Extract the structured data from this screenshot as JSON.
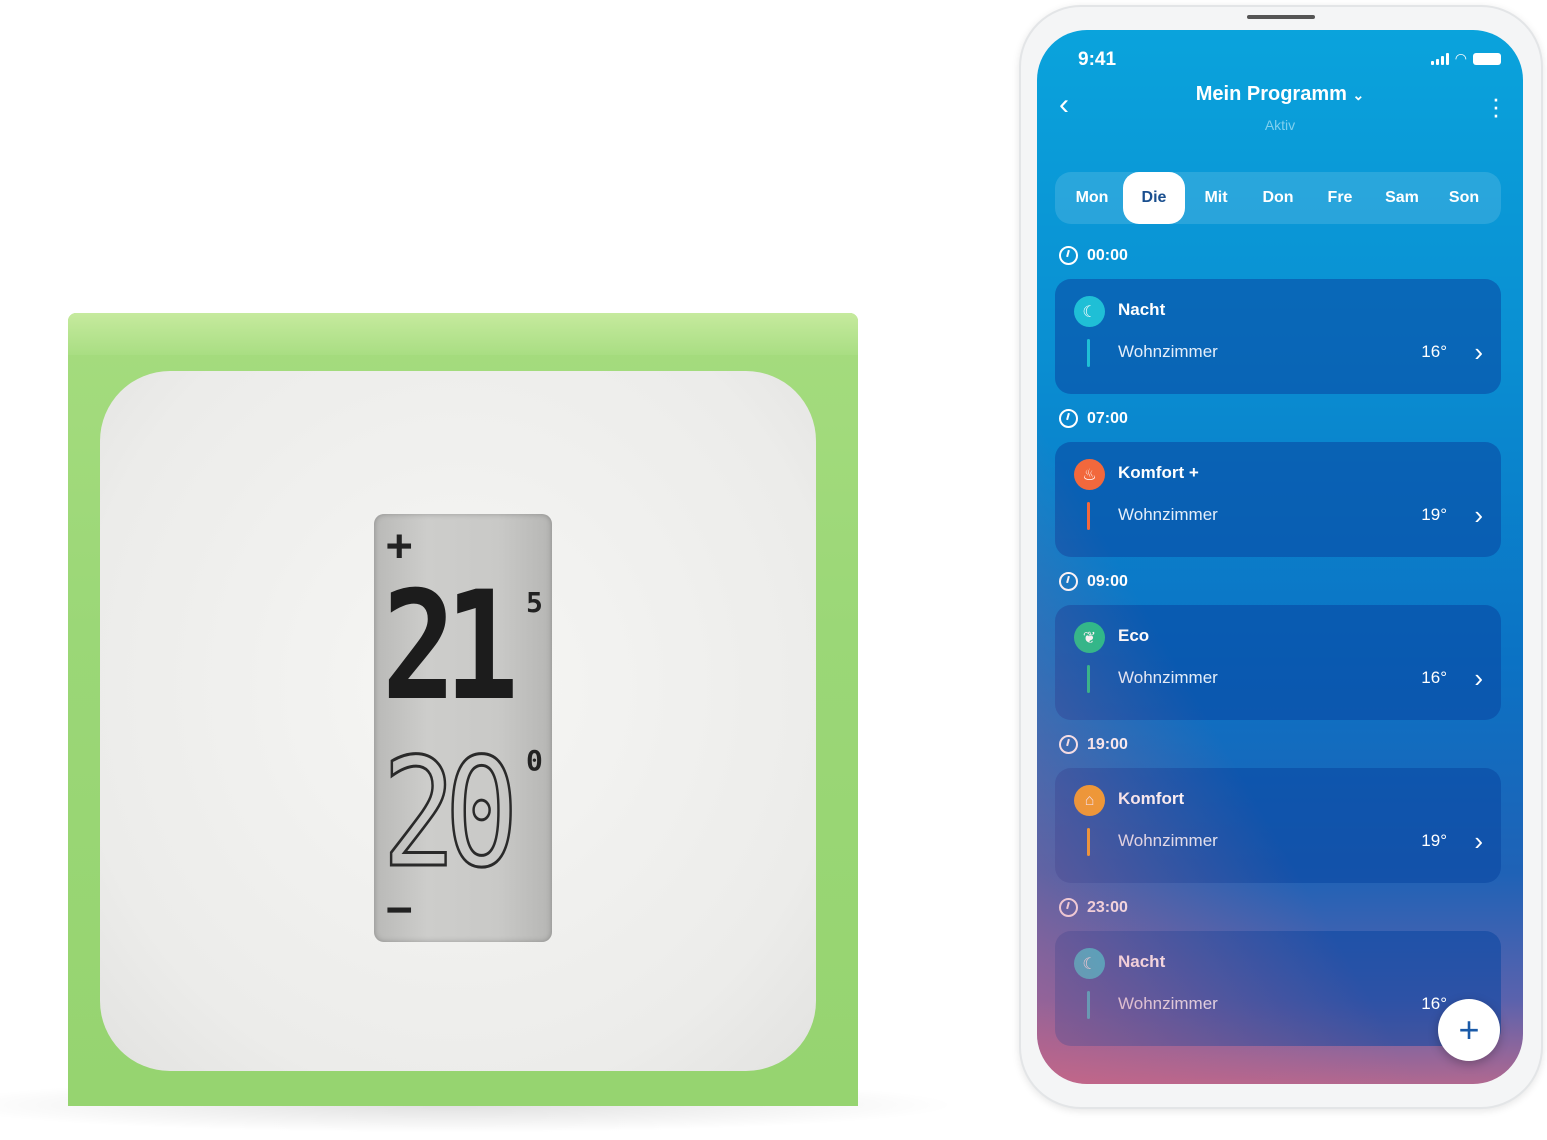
{
  "thermostat": {
    "plus": "+",
    "minus": "−",
    "current_temp": "21",
    "current_decimal": "5",
    "target_temp": "20",
    "target_decimal": "0"
  },
  "app": {
    "status_time": "9:41",
    "title": "Mein Programm",
    "subtitle": "Aktiv",
    "days": [
      "Mon",
      "Die",
      "Mit",
      "Don",
      "Fre",
      "Sam",
      "Son"
    ],
    "selected_day": "Die",
    "schedule": [
      {
        "time": "00:00",
        "mode": "Nacht",
        "room": "Wohnzimmer",
        "temp": "16°",
        "icon": "moon-icon",
        "color": "#1fbfd6"
      },
      {
        "time": "07:00",
        "mode": "Komfort +",
        "room": "Wohnzimmer",
        "temp": "19°",
        "icon": "flame-icon",
        "color": "#f2683c"
      },
      {
        "time": "09:00",
        "mode": "Eco",
        "room": "Wohnzimmer",
        "temp": "16°",
        "icon": "leaf-icon",
        "color": "#22c08a"
      },
      {
        "time": "19:00",
        "mode": "Komfort",
        "room": "Wohnzimmer",
        "temp": "19°",
        "icon": "home-icon",
        "color": "#f6a623"
      },
      {
        "time": "23:00",
        "mode": "Nacht",
        "room": "Wohnzimmer",
        "temp": "16°",
        "icon": "moon-icon",
        "color": "#1fbfd6"
      }
    ],
    "fab_icon": "plus-icon"
  }
}
